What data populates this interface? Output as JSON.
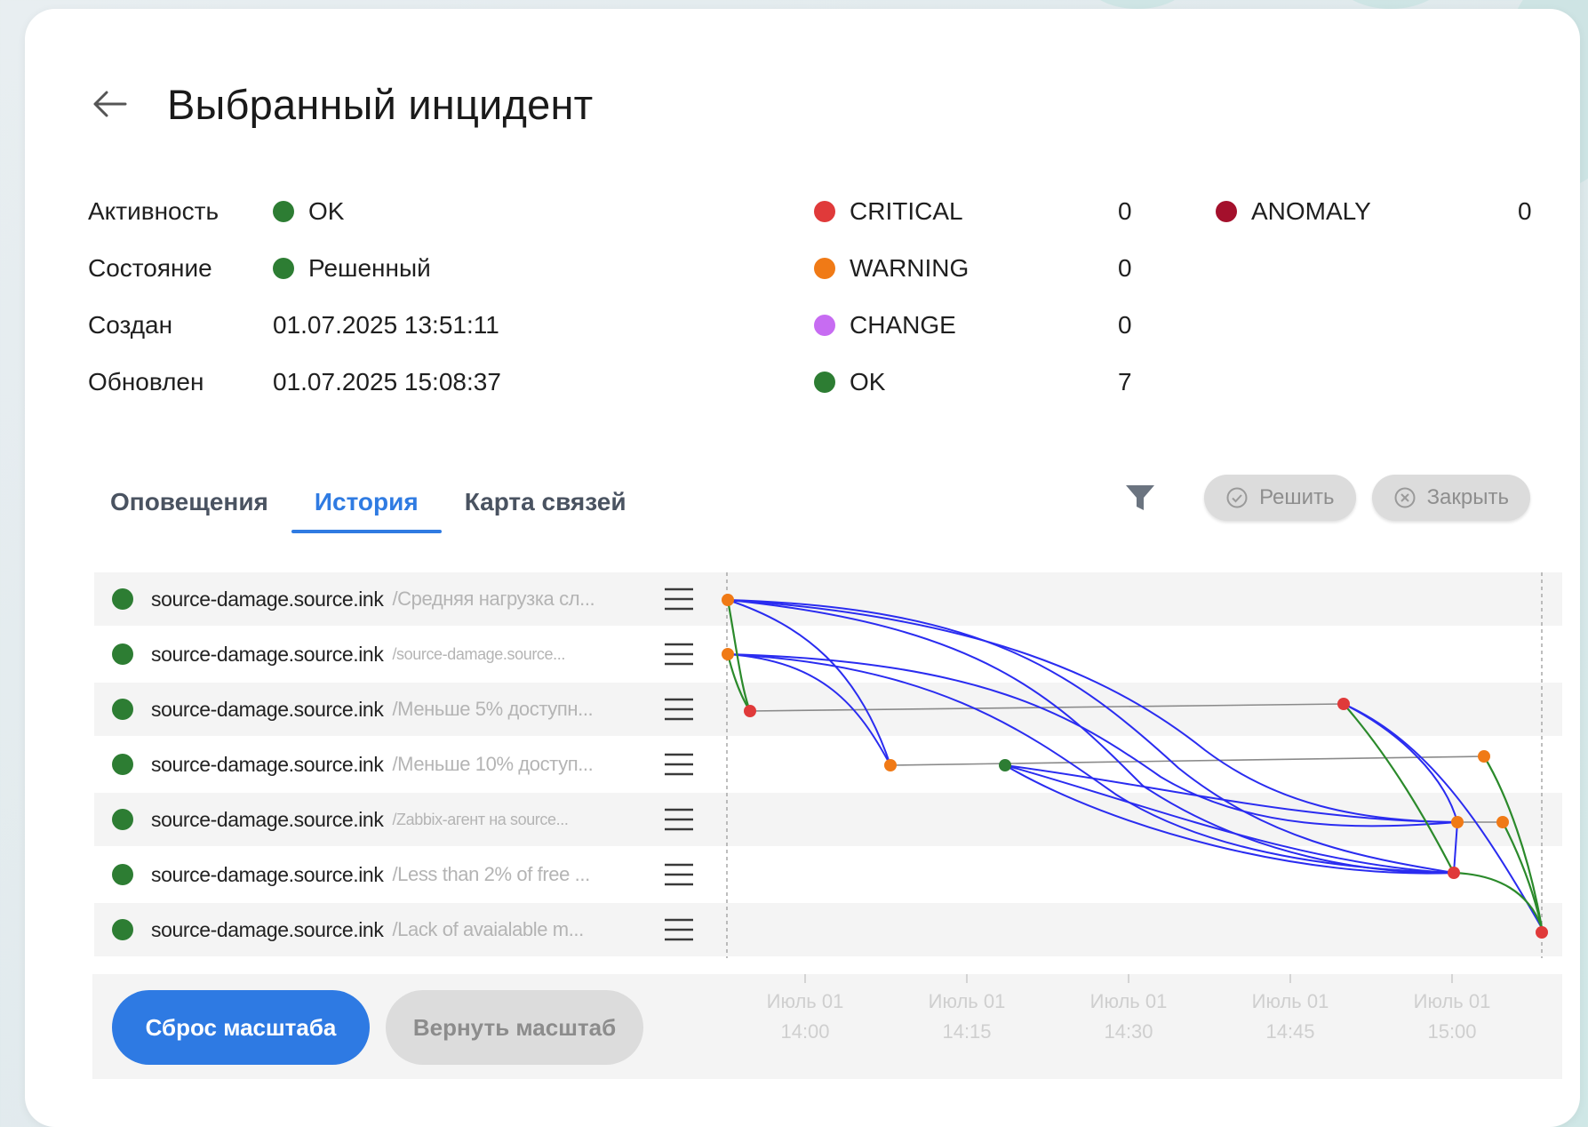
{
  "header": {
    "title": "Выбранный инцидент"
  },
  "info": [
    {
      "label": "Активность",
      "value": "OK",
      "dot": "#2d7d33"
    },
    {
      "label": "Состояние",
      "value": "Решенный",
      "dot": "#2d7d33"
    },
    {
      "label": "Создан",
      "value": "01.07.2025 13:51:11",
      "dot": null
    },
    {
      "label": "Обновлен",
      "value": "01.07.2025 15:08:37",
      "dot": null
    }
  ],
  "counts": [
    {
      "name": "CRITICAL",
      "value": "0",
      "color": "#e03a3a"
    },
    {
      "name": "WARNING",
      "value": "0",
      "color": "#f07a16"
    },
    {
      "name": "CHANGE",
      "value": "0",
      "color": "#c76cf2"
    },
    {
      "name": "OK",
      "value": "7",
      "color": "#2d7d33"
    }
  ],
  "counts_extra": [
    {
      "name": "ANOMALY",
      "value": "0",
      "color": "#a4102c"
    }
  ],
  "tabs": [
    {
      "label": "Оповещения",
      "active": false
    },
    {
      "label": "История",
      "active": true
    },
    {
      "label": "Карта связей",
      "active": false
    }
  ],
  "toolbar": {
    "resolve_label": "Решить",
    "close_label": "Закрыть"
  },
  "history": [
    {
      "host": "source-damage.source.ink",
      "desc": "/Средняя нагрузка сл...",
      "small": false
    },
    {
      "host": "source-damage.source.ink",
      "desc": "/source-damage.source...",
      "small": true
    },
    {
      "host": "source-damage.source.ink",
      "desc": "/Меньше 5% доступн...",
      "small": false
    },
    {
      "host": "source-damage.source.ink",
      "desc": "/Меньше 10% доступ...",
      "small": false
    },
    {
      "host": "source-damage.source.ink",
      "desc": "/Zabbix-агент на source...",
      "small": true
    },
    {
      "host": "source-damage.source.ink",
      "desc": "/Less than 2% of free ...",
      "small": false
    },
    {
      "host": "source-damage.source.ink",
      "desc": "/Lack of avaialable m...",
      "small": false
    }
  ],
  "timeline": {
    "ticks": [
      {
        "date": "Июль 01",
        "time": "14:00"
      },
      {
        "date": "Июль 01",
        "time": "14:15"
      },
      {
        "date": "Июль 01",
        "time": "14:30"
      },
      {
        "date": "Июль 01",
        "time": "14:45"
      },
      {
        "date": "Июль 01",
        "time": "15:00"
      }
    ],
    "reset_label": "Сброс масштаба",
    "restore_label": "Вернуть масштаб"
  },
  "colors": {
    "accent": "#2e7ae3",
    "ok": "#2d7d33",
    "critical": "#e03a3a",
    "warning": "#f07a16",
    "link": "#2a2cf0",
    "ok_link": "#2b8a2b"
  }
}
